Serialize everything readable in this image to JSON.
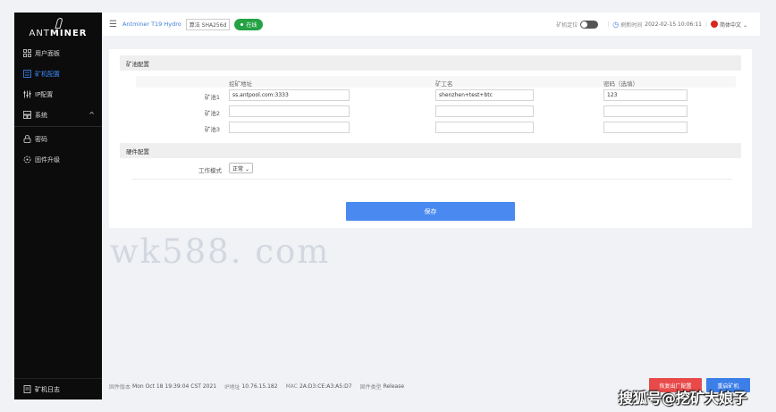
{
  "brand": {
    "text_light": "ANT",
    "text_bold": "MINER"
  },
  "sidebar": {
    "items": [
      {
        "label": "用户面板",
        "icon": "dashboard-icon",
        "active": false
      },
      {
        "label": "矿机配置",
        "icon": "config-icon",
        "active": true
      },
      {
        "label": "IP配置",
        "icon": "sliders-icon",
        "active": false
      },
      {
        "label": "系统",
        "icon": "system-icon",
        "active": false
      },
      {
        "label": "密码",
        "icon": "lock-icon",
        "active": false
      },
      {
        "label": "固件升级",
        "icon": "upgrade-icon",
        "active": false
      }
    ],
    "footer": {
      "label": "矿机日志",
      "icon": "log-icon"
    }
  },
  "topbar": {
    "model": "Antminer T19 Hydro",
    "algorithm": "算法 SHA256d",
    "status": "在线",
    "locate_label": "矿机定位",
    "time_label": "刷新时间",
    "time_value": "2022-02-15 10:06:11",
    "language": "简体中文"
  },
  "pool_config": {
    "title": "矿池配置",
    "headers": {
      "address": "挖矿地址",
      "worker": "矿工名",
      "password": "密码（选填）"
    },
    "rows": [
      {
        "label": "矿池1",
        "address": "ss.antpool.com:3333",
        "worker": "shenzhen+test+btc",
        "password": "123"
      },
      {
        "label": "矿池2",
        "address": "",
        "worker": "",
        "password": ""
      },
      {
        "label": "矿池3",
        "address": "",
        "worker": "",
        "password": ""
      }
    ]
  },
  "hardware_config": {
    "title": "硬件配置",
    "work_mode_label": "工作模式",
    "work_mode_value": "正常"
  },
  "save_label": "保存",
  "watermark": "wk588. com",
  "statusbar": {
    "firmware_version_label": "固件版本",
    "firmware_version_value": "Mon Oct 18 19:39:04 CST 2021",
    "ip_label": "IP地址",
    "ip_value": "10.76.15.182",
    "mac_label": "MAC",
    "mac_value": "2A:D3:CE:A3:A5:D7",
    "firmware_type_label": "固件类型",
    "firmware_type_value": "Release"
  },
  "actions": {
    "reset_config_label": "恢复出厂配置",
    "reboot_label": "重启矿机"
  },
  "overlay_text": "搜狐号@挖矿大娘子",
  "colors": {
    "accent": "#3d7fd9",
    "online": "#25a244",
    "danger": "#e84a4a",
    "sidebar_bg": "#0c0c0c"
  }
}
